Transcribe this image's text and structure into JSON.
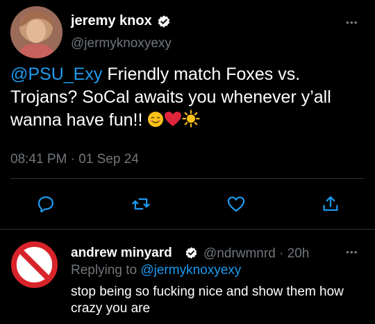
{
  "tweet": {
    "display_name": "jeremy knox",
    "handle": "@jermyknoxyexy",
    "mention": "@PSU_Exy",
    "text": " Friendly match Foxes vs. Trojans? SoCal awaits you whenever y’all wanna have fun!! ",
    "emojis": [
      "smiling-face",
      "red-heart",
      "sun"
    ],
    "timestamp": "08:41 PM · 01 Sep 24",
    "actions": [
      "reply-icon",
      "retweet-icon",
      "like-icon",
      "share-icon"
    ],
    "more_label": "•••"
  },
  "reply": {
    "display_name": "andrew minyard",
    "handle": "@ndrwmnrd · 20h",
    "replying_prefix": "Replying to ",
    "replying_handle": "@jermyknoxyexy",
    "text": "stop being so fucking nice and show them how crazy you are",
    "more_label": "•••"
  },
  "colors": {
    "background": "#000000",
    "accent": "#1d9bf0",
    "secondary_text": "#71767b",
    "divider": "#2f3336",
    "prohibited_red": "#d8232a"
  }
}
